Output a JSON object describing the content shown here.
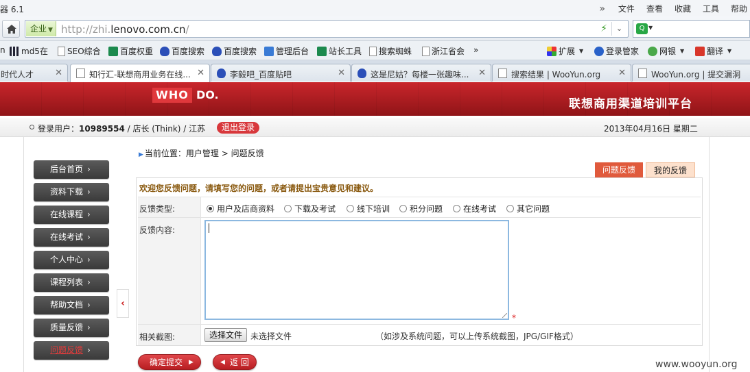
{
  "browser": {
    "app_name": "器 6.1",
    "menu": [
      "文件",
      "查看",
      "收藏",
      "工具",
      "帮助"
    ],
    "zone_label": "企业",
    "url_prefix": "http://zhi.",
    "url_domain": "lenovo.com.cn",
    "url_suffix": "/",
    "bookmarks": [
      {
        "label": "md5在",
        "icon": "grid-icon"
      },
      {
        "label": "SEO综合",
        "icon": "page-icon"
      },
      {
        "label": "百度权重",
        "icon": "seo-icon"
      },
      {
        "label": "百度搜索",
        "icon": "baidu-paw-icon"
      },
      {
        "label": "百度搜索",
        "icon": "baidu-paw-icon"
      },
      {
        "label": "管理后台",
        "icon": "admin-icon"
      },
      {
        "label": "站长工具",
        "icon": "tool-icon"
      },
      {
        "label": "搜索蜘蛛",
        "icon": "page-icon"
      },
      {
        "label": "浙江省会",
        "icon": "page-icon"
      }
    ],
    "bookmark_prefix": "n",
    "bookmark_more": "»",
    "toolbar_right": [
      {
        "label": "扩展",
        "icon": "extensions-icon"
      },
      {
        "label": "登录管家",
        "icon": "key-icon"
      },
      {
        "label": "网银",
        "icon": "bank-icon"
      },
      {
        "label": "翻译",
        "icon": "translate-icon"
      }
    ],
    "tabs": [
      {
        "label": "时代人才",
        "icon": "none"
      },
      {
        "label": "知行汇-联想商用业务在线...",
        "icon": "page-icon",
        "active": true
      },
      {
        "label": "李毅吧_百度贴吧",
        "icon": "baidu-paw-icon"
      },
      {
        "label": "这是尼姑？每楼一张趣味...",
        "icon": "baidu-paw-icon"
      },
      {
        "label": "搜索结果 | WooYun.org",
        "icon": "page-icon"
      },
      {
        "label": "WooYun.org | 提交漏洞",
        "icon": "page-icon"
      }
    ]
  },
  "site": {
    "logo_who": "WHO",
    "logo_do": "DO.",
    "subtitle": "联想商用渠道培训平台",
    "user_prefix": "登录用户：",
    "user_id": "10989554",
    "user_role": " / 店长 (Think) / 江苏",
    "logout": "退出登录",
    "date": "2013年04月16日  星期二"
  },
  "sidebar": {
    "items": [
      {
        "label": "后台首页"
      },
      {
        "label": "资料下载"
      },
      {
        "label": "在线课程"
      },
      {
        "label": "在线考试"
      },
      {
        "label": "个人中心"
      },
      {
        "label": "课程列表"
      },
      {
        "label": "帮助文档"
      },
      {
        "label": "质量反馈"
      },
      {
        "label": "问题反馈",
        "current": true
      }
    ],
    "collapse": "‹"
  },
  "breadcrumb": "当前位置：用户管理 > 问题反馈",
  "feedback_tabs": {
    "active": "问题反馈",
    "other": "我的反馈"
  },
  "form": {
    "welcome": "欢迎您反馈问题，请填写您的问题，或者请提出宝贵意见和建议。",
    "type_label": "反馈类型:",
    "types": [
      "用户及店商资料",
      "下载及考试",
      "线下培训",
      "积分问题",
      "在线考试",
      "其它问题"
    ],
    "selected_type": 0,
    "content_label": "反馈内容:",
    "content_value": "",
    "required_mark": "*",
    "screenshot_label": "相关截图:",
    "file_button": "选择文件",
    "file_status": "未选择文件",
    "file_hint": "（如涉及系统问题，可以上传系统截图，JPG/GIF格式）"
  },
  "actions": {
    "submit": "确定提交",
    "back": "返 回"
  },
  "watermark": "www.wooyun.org"
}
